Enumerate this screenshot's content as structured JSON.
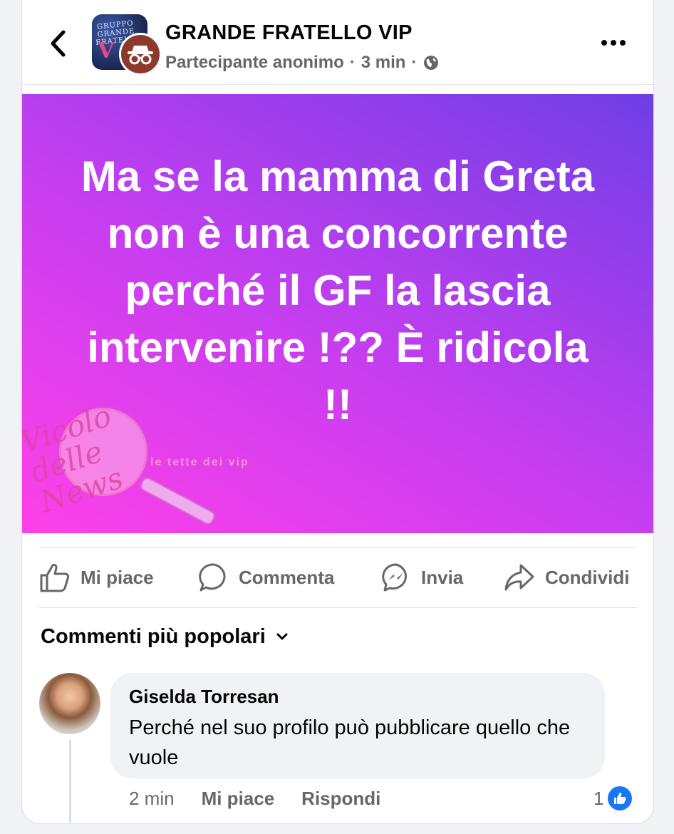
{
  "header": {
    "group_name": "GRANDE FRATELLO VIP",
    "author": "Partecipante anonimo",
    "separator": "·",
    "time": "3 min",
    "separator2": "·",
    "avatar_text": "GRUPPO\nGRANDE\nFRATELLO",
    "avatar_letter": "V",
    "privacy_icon": "globe-icon",
    "back_icon": "chevron-left-icon",
    "more_icon": "more-dots-icon"
  },
  "post": {
    "text": "Ma se la mamma di Greta non è una concorrente perché il GF la lascia intervenire !?? È ridicola !!",
    "gradient_colors": [
      "#ff40e8",
      "#c73ef0",
      "#6f3ee6"
    ],
    "watermark": {
      "script": "Vicolo\ndelle\nNews",
      "tag": "le tette dei vip"
    }
  },
  "actions": {
    "like": "Mi piace",
    "comment": "Commenta",
    "send": "Invia",
    "share": "Condividi"
  },
  "comments": {
    "filter": "Commenti più popolari",
    "items": [
      {
        "author": "Giselda Torresan",
        "text": "Perché nel suo profilo può pubblicare quello che vuole",
        "time": "2 min",
        "like_label": "Mi piace",
        "reply_label": "Rispondi",
        "reaction_count": "1"
      }
    ]
  },
  "colors": {
    "accent": "#1877f2",
    "secondary_text": "#65676b",
    "primary_text": "#050505",
    "bubble": "#f0f2f5"
  }
}
